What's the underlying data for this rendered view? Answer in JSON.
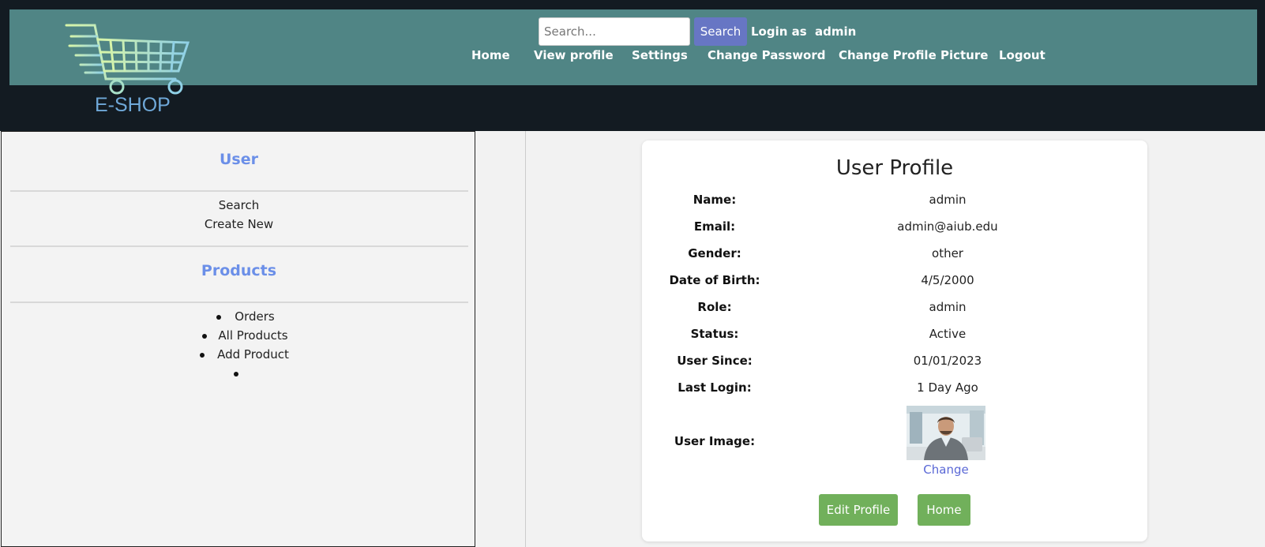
{
  "header": {
    "logo_text": "E-SHOP",
    "search": {
      "placeholder": "Search...",
      "button_label": "Search"
    },
    "login_label": "Login as",
    "login_user": "admin",
    "nav": [
      "Home",
      "View profile",
      "Settings",
      "Change Password",
      "Change Profile Picture",
      "Logout"
    ]
  },
  "sidebar": {
    "user_heading": "User",
    "user_links": [
      "Search",
      "Create New"
    ],
    "products_heading": "Products",
    "product_links": [
      "Orders",
      "All Products",
      "Add Product",
      ""
    ]
  },
  "profile": {
    "title": "User Profile",
    "fields": [
      {
        "label": "Name:",
        "value": "admin"
      },
      {
        "label": "Email:",
        "value": "admin@aiub.edu"
      },
      {
        "label": "Gender:",
        "value": "other"
      },
      {
        "label": "Date of Birth:",
        "value": "4/5/2000"
      },
      {
        "label": "Role:",
        "value": "admin"
      },
      {
        "label": "Status:",
        "value": "Active"
      },
      {
        "label": "User Since:",
        "value": "01/01/2023"
      },
      {
        "label": "Last Login:",
        "value": "1 Day Ago"
      }
    ],
    "image_label": "User Image:",
    "change_link": "Change",
    "edit_button": "Edit Profile",
    "home_button": "Home"
  },
  "colors": {
    "nav_bg": "#508585",
    "header_bg": "#131b22",
    "accent_blue": "#6b8fe8",
    "button_green": "#71b05b",
    "search_button": "#6776c4"
  }
}
